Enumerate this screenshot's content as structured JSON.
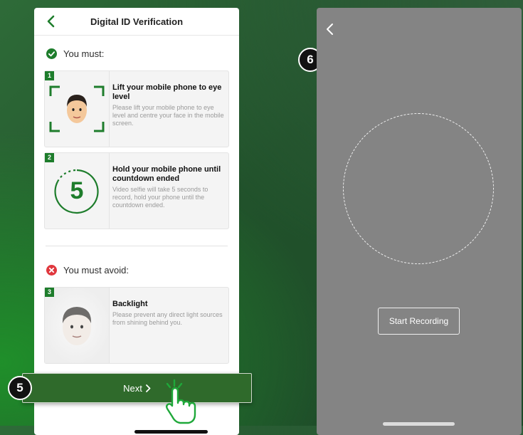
{
  "screen1": {
    "title": "Digital ID Verification",
    "must_label": "You must:",
    "avoid_label": "You must avoid:",
    "items": [
      {
        "num": "1",
        "title": "Lift your mobile phone to eye level",
        "desc": "Please lift your mobile phone to eye level and centre your face in the mobile screen."
      },
      {
        "num": "2",
        "title": "Hold your mobile phone until countdown ended",
        "desc": "Video selfie will take 5 seconds to record, hold your phone until the countdown ended.",
        "countdown": "5"
      },
      {
        "num": "3",
        "title": "Backlight",
        "desc": "Please prevent any direct light sources from shining behind you."
      }
    ],
    "next_label": "Next"
  },
  "screen2": {
    "start_recording_label": "Start Recording"
  },
  "steps": {
    "step5": "5",
    "step6": "6"
  },
  "icons": {
    "back": "chevron-left-icon",
    "check": "check-circle-icon",
    "avoid": "x-circle-icon",
    "next": "chevron-right-icon",
    "hand": "hand-pointer-icon"
  },
  "colors": {
    "accent_green": "#1e7d2c",
    "next_bar": "#2f6a2b",
    "avoid_red": "#e0383e",
    "camera_bg": "#848484"
  }
}
